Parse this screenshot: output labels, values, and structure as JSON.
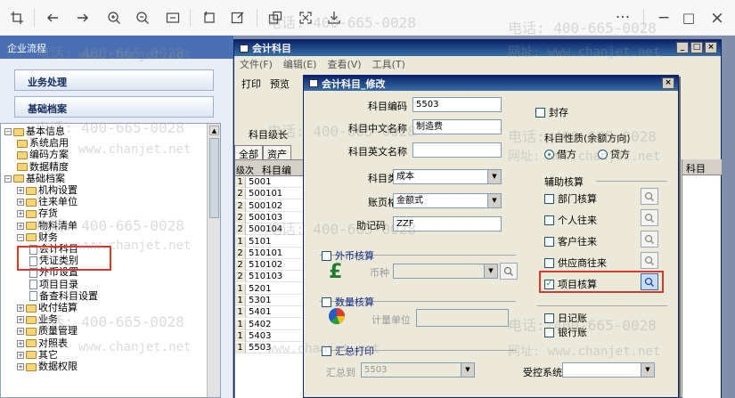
{
  "viewer": {
    "buttons": [
      "crop-icon",
      "back-arrow-icon",
      "forward-arrow-icon",
      "zoom-in-icon",
      "zoom-out-icon",
      "fit-page-icon",
      "rotate-icon",
      "edit-icon",
      "share-image-icon",
      "expand-icon",
      "download-icon",
      "more-icon",
      "minimize-icon",
      "maximize-icon",
      "close-icon"
    ],
    "more_label": "···",
    "minimize_label": "−",
    "maximize_label": "□",
    "close_label": "×"
  },
  "watermark": {
    "phone": "电话: 400-665-0028",
    "site": "www.chanjet.net",
    "site_cn": "网址: www.chanjet.net"
  },
  "left_panel": {
    "title": "企业流程",
    "modules": [
      "业务处理",
      "基础档案"
    ],
    "tree": [
      {
        "label": "基本信息",
        "kind": "folder",
        "sign": "−"
      },
      {
        "label": "系统启用",
        "kind": "folder",
        "sign": ""
      },
      {
        "label": "编码方案",
        "kind": "folder",
        "sign": ""
      },
      {
        "label": "数据精度",
        "kind": "folder",
        "sign": ""
      },
      {
        "label": "基础档案",
        "kind": "folder",
        "sign": "−"
      },
      {
        "label": "机构设置",
        "kind": "folder",
        "sign": "+"
      },
      {
        "label": "往来单位",
        "kind": "folder",
        "sign": "+"
      },
      {
        "label": "存货",
        "kind": "folder",
        "sign": "+"
      },
      {
        "label": "物料清单",
        "kind": "folder",
        "sign": "+"
      },
      {
        "label": "财务",
        "kind": "folder",
        "sign": "−"
      },
      {
        "label": "会计科目",
        "kind": "doc",
        "sign": ""
      },
      {
        "label": "凭证类别",
        "kind": "doc",
        "sign": ""
      },
      {
        "label": "外币设置",
        "kind": "doc",
        "sign": ""
      },
      {
        "label": "项目目录",
        "kind": "doc",
        "sign": ""
      },
      {
        "label": "备查科目设置",
        "kind": "doc",
        "sign": ""
      },
      {
        "label": "收付结算",
        "kind": "folder",
        "sign": "+"
      },
      {
        "label": "业务",
        "kind": "folder",
        "sign": "+"
      },
      {
        "label": "质量管理",
        "kind": "folder",
        "sign": "+"
      },
      {
        "label": "对照表",
        "kind": "folder",
        "sign": "+"
      },
      {
        "label": "其它",
        "kind": "folder",
        "sign": "+"
      },
      {
        "label": "数据权限",
        "kind": "folder",
        "sign": "+"
      }
    ]
  },
  "outer_window": {
    "title": "会计科目",
    "win_min": "_",
    "win_max": "□",
    "win_close": "×",
    "menu": [
      "文件(F)",
      "编辑(E)",
      "查看(V)",
      "工具(T)"
    ],
    "toolbar": [
      "打印",
      "预览"
    ],
    "level_label": "科目级长",
    "tabs": [
      "全部",
      "资产"
    ],
    "grid_header": [
      "级次",
      "科目编"
    ],
    "right_col_header": "科目",
    "rows": [
      {
        "level": "1",
        "code": "5001"
      },
      {
        "level": "2",
        "code": "500101"
      },
      {
        "level": "2",
        "code": "500102"
      },
      {
        "level": "2",
        "code": "500103"
      },
      {
        "level": "2",
        "code": "500104"
      },
      {
        "level": "1",
        "code": "5101"
      },
      {
        "level": "2",
        "code": "510101"
      },
      {
        "level": "2",
        "code": "510102"
      },
      {
        "level": "2",
        "code": "510103"
      },
      {
        "level": "1",
        "code": "5201"
      },
      {
        "level": "1",
        "code": "5301"
      },
      {
        "level": "1",
        "code": "5401"
      },
      {
        "level": "1",
        "code": "5402"
      },
      {
        "level": "1",
        "code": "5403"
      },
      {
        "level": "1",
        "code": "5503"
      }
    ]
  },
  "dialog": {
    "title": "会计科目_修改",
    "close": "×",
    "fields": {
      "code_label": "科目编码",
      "code_value": "5503",
      "cn_name_label": "科目中文名称",
      "cn_name_value": "制造费",
      "en_name_label": "科目英文名称",
      "en_name_value": "",
      "type_label": "科目类型",
      "type_value": "成本",
      "format_label": "账页格式",
      "format_value": "金额式",
      "mnemonic_label": "助记码",
      "mnemonic_value": "ZZF"
    },
    "seal_label": "封存",
    "nature_title": "科目性质(余额方向)",
    "debit_label": "借方",
    "credit_label": "贷方",
    "aux_title": "辅助核算",
    "aux": [
      {
        "label": "部门核算",
        "checked": false
      },
      {
        "label": "个人往来",
        "checked": false
      },
      {
        "label": "客户往来",
        "checked": false
      },
      {
        "label": "供应商往来",
        "checked": false
      },
      {
        "label": "项目核算",
        "checked": true
      }
    ],
    "journal_label": "日记账",
    "bank_label": "银行账",
    "fx_label": "外币核算",
    "currency_label": "币种",
    "qty_label": "数量核算",
    "unit_label": "计量单位",
    "summary_print_label": "汇总打印",
    "summary_to_label": "汇总到",
    "summary_to_value": "5503",
    "controlled_label": "受控系统",
    "controlled_value": ""
  },
  "colors": {
    "highlight_red": "#d9382c",
    "title_blue": "#0a246a",
    "check_green": "#21a121"
  }
}
